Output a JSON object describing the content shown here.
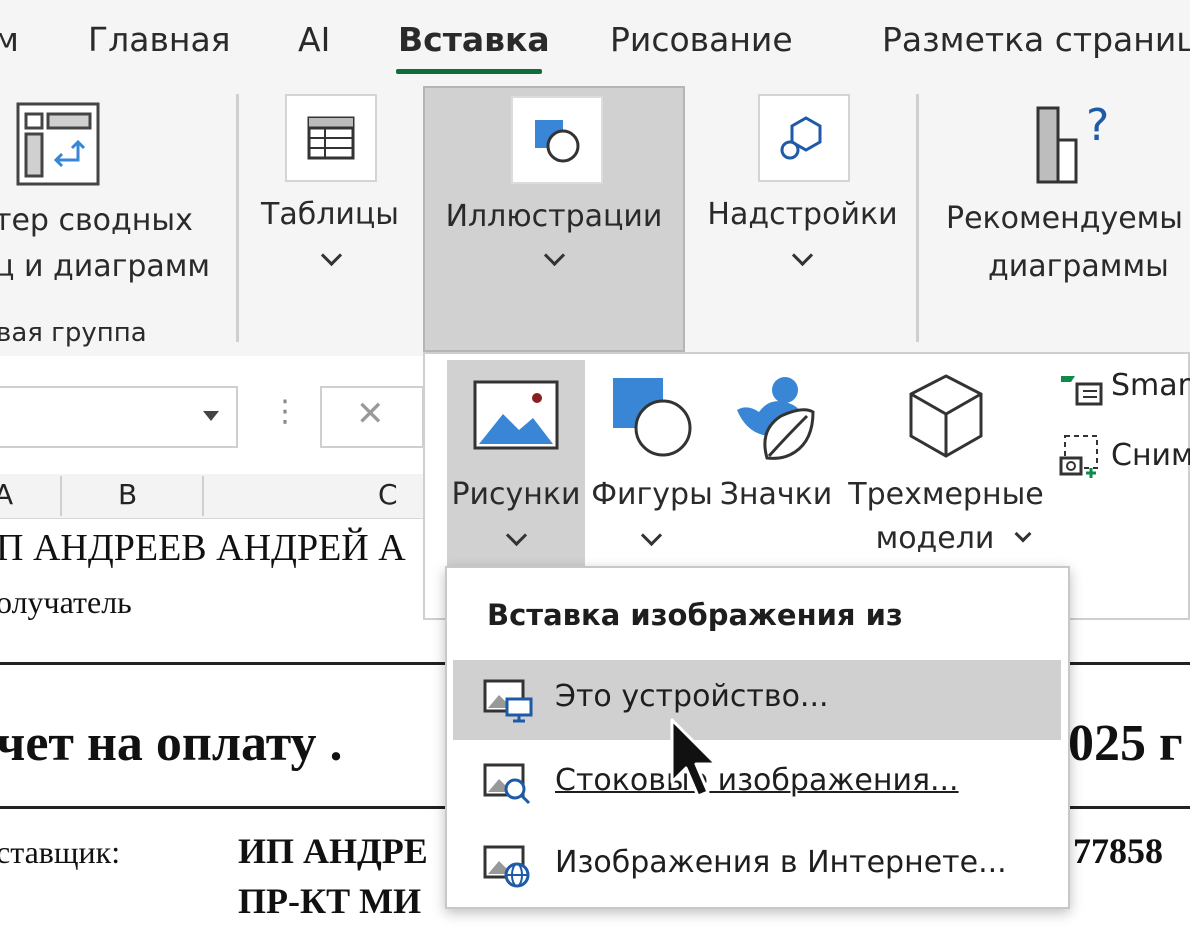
{
  "tabs": [
    {
      "label": "м"
    },
    {
      "label": "Главная"
    },
    {
      "label": "AI"
    },
    {
      "label": "Вставка"
    },
    {
      "label": "Рисование"
    },
    {
      "label": "Разметка страниц"
    }
  ],
  "ribbon": {
    "pivot_wizard": {
      "line1": "тер сводных",
      "line2": "ц и диаграмм"
    },
    "group_label": "вая группа",
    "tables": {
      "label": "Таблицы"
    },
    "illustrations": {
      "label": "Иллюстрации"
    },
    "addins": {
      "label": "Надстройки"
    },
    "recommended_charts": {
      "line1": "Рекомендуемы",
      "line2": "диаграммы"
    }
  },
  "formula_bar": {
    "cancel_glyph": "✕",
    "more_glyph": "⋮"
  },
  "sheet": {
    "col_a": "A",
    "col_b": "B",
    "col_c": "C",
    "row1": "П АНДРЕЕВ АНДРЕЙ А",
    "row2": "олучатель",
    "invoice_left": "чет на оплату .",
    "invoice_right": "025 г",
    "supplier_label": "ставщик:",
    "supplier_value": "ИП АНДРЕ",
    "supplier_inn": "I 77858",
    "address": "ПР-КТ МИ"
  },
  "illustrations_panel": {
    "pictures": {
      "label": "Рисунки"
    },
    "shapes": {
      "label": "Фигуры"
    },
    "icons": {
      "label": "Значки"
    },
    "models3d": {
      "line1": "Трехмерные",
      "line2": "модели"
    },
    "smartart": {
      "label": "Smar"
    },
    "screenshot": {
      "label": "Сним"
    }
  },
  "image_menu": {
    "header": "Вставка изображения из",
    "items": [
      {
        "label": "Это устройство...",
        "icon": "device-image-icon"
      },
      {
        "label": "Стоковые изображения...",
        "icon": "stock-images-icon"
      },
      {
        "label": "Изображения в Интернете...",
        "icon": "online-images-icon"
      }
    ]
  },
  "colors": {
    "accent_green": "#0f6c3c",
    "icon_blue": "#3a86d6",
    "ribbon_bg": "#f5f5f5",
    "highlight": "#d0d0d0"
  }
}
